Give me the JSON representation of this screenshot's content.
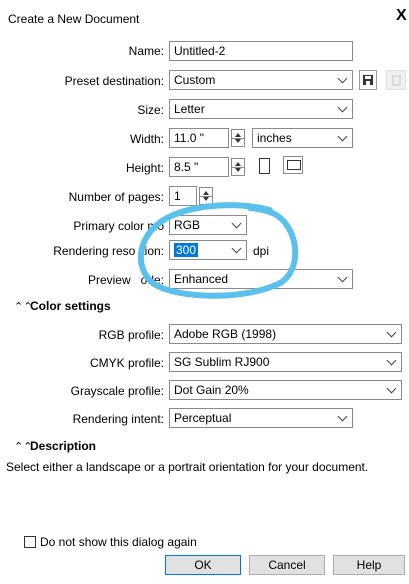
{
  "dialog": {
    "title": "Create a New Document",
    "close_glyph": "X"
  },
  "fields": {
    "name": {
      "label": "Name:",
      "value": "Untitled-2"
    },
    "preset": {
      "label": "Preset destination:",
      "value": "Custom"
    },
    "size": {
      "label": "Size:",
      "value": "Letter"
    },
    "width": {
      "label": "Width:",
      "value": "11.0 \"",
      "unit": "inches"
    },
    "height": {
      "label": "Height:",
      "value": "8.5 \""
    },
    "pages": {
      "label": "Number of pages:",
      "value": "1"
    },
    "color_mode": {
      "label": "Primary color mo",
      "value": "RGB"
    },
    "resolution": {
      "label": "Rendering reso",
      "label_suffix": "tion:",
      "value": "300",
      "unit": "dpi"
    },
    "preview": {
      "label": "Preview",
      "label_suffix": "ode:",
      "value": "Enhanced"
    }
  },
  "color_settings": {
    "heading": "Color settings",
    "rgb_profile": {
      "label": "RGB profile:",
      "value": "Adobe RGB (1998)"
    },
    "cmyk_profile": {
      "label": "CMYK profile:",
      "value": "SG Sublim RJ900"
    },
    "grayscale_profile": {
      "label": "Grayscale profile:",
      "value": "Dot Gain 20%"
    },
    "rendering_intent": {
      "label": "Rendering intent:",
      "value": "Perceptual"
    }
  },
  "description": {
    "heading": "Description",
    "text": "Select either a landscape or a portrait orientation for your document."
  },
  "footer": {
    "checkbox_label": "Do not show this dialog again",
    "ok": "OK",
    "cancel": "Cancel",
    "help": "Help"
  },
  "icons": {
    "save": "save-icon",
    "delete": "trash-icon",
    "portrait": "portrait-icon",
    "landscape": "landscape-icon",
    "collapse": "chevron-up-icon"
  },
  "colors": {
    "accent": "#0078d7",
    "annotation_circle": "#5bc0eb"
  }
}
